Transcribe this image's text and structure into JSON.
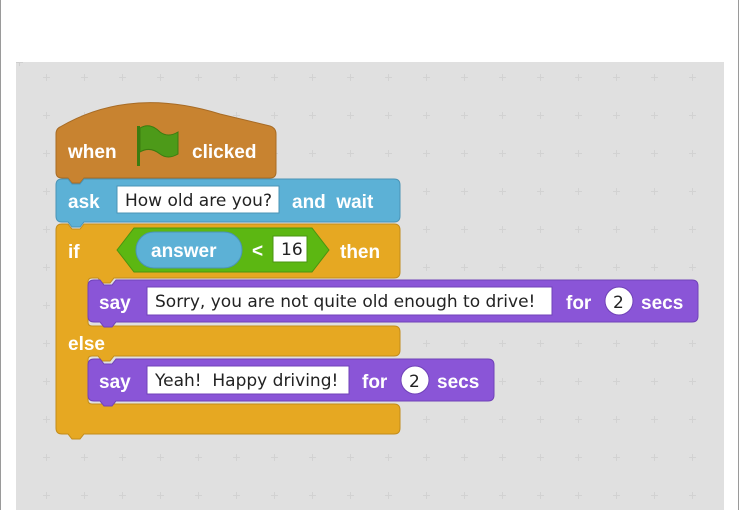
{
  "hat_block": {
    "when": "when",
    "clicked": "clicked",
    "icon": "green-flag-icon"
  },
  "ask_block": {
    "keyword": "ask",
    "question": "How old are you?",
    "and_wait": "and  wait"
  },
  "if_block": {
    "if": "if",
    "then": "then",
    "else": "else"
  },
  "condition": {
    "reporter": "answer",
    "operator": "<",
    "value": "16"
  },
  "say_block_1": {
    "keyword": "say",
    "message": "Sorry, you are not quite old enough to drive!",
    "for": "for",
    "seconds": "2",
    "secs": "secs"
  },
  "say_block_2": {
    "keyword": "say",
    "message": "Yeah!  Happy driving!",
    "for": "for",
    "seconds": "2",
    "secs": "secs"
  },
  "colors": {
    "events": "#c88330",
    "sensing": "#5cb1d6",
    "control": "#e6a822",
    "operators": "#5cb712",
    "looks": "#8a55d7",
    "canvas": "#e0e0e0"
  }
}
